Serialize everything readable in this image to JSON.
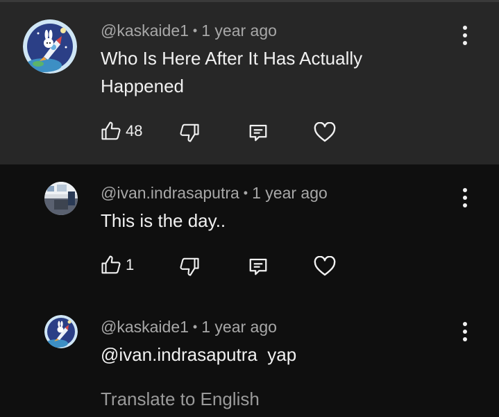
{
  "comments": [
    {
      "author": "@kaskaide1",
      "time": "1 year ago",
      "text_line1": "Who Is Here After It Has Actually",
      "text_line2": "Happened",
      "likes": "48"
    },
    {
      "author": "@ivan.indrasaputra",
      "time": "1 year ago",
      "text": "This is the day..",
      "likes": "1"
    },
    {
      "author": "@kaskaide1",
      "time": "1 year ago",
      "text": "@ivan.indrasaputra  yap",
      "translate_label": "Translate to English"
    }
  ],
  "separator": "•",
  "icons": {
    "like": "thumb-up-icon",
    "dislike": "thumb-down-icon",
    "reply": "reply-icon",
    "heart": "heart-icon",
    "more": "more-vert-icon"
  },
  "colors": {
    "highlight_bg": "#272727",
    "page_bg": "#0f0f0f",
    "meta_text": "#a8a8a8",
    "translate_text": "#9a9a9a"
  }
}
